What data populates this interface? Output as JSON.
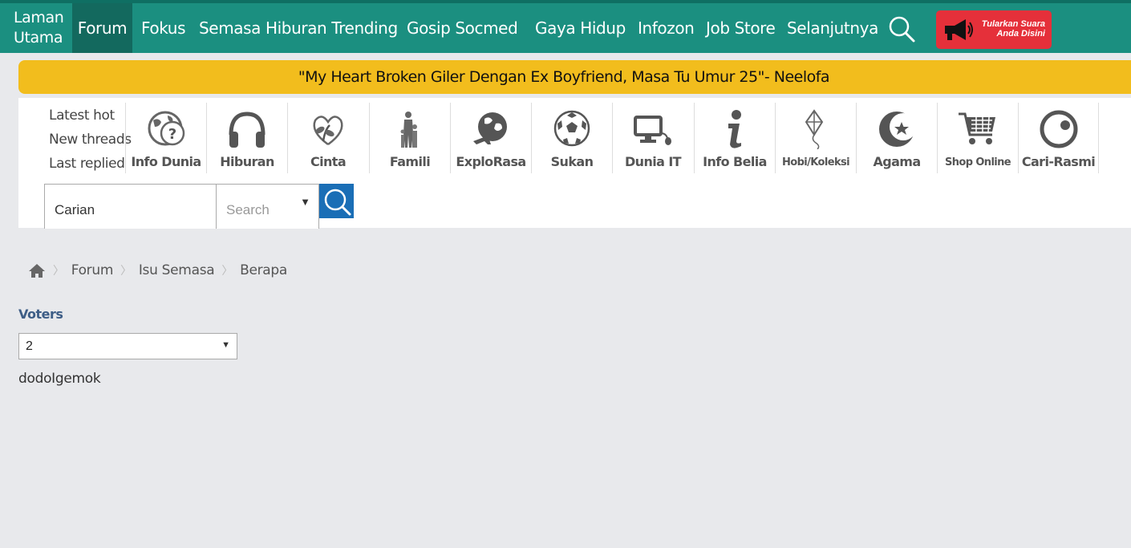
{
  "nav": {
    "home_line1": "Laman",
    "home_line2": "Utama",
    "items": [
      "Forum",
      "Fokus",
      "Semasa",
      "Hiburan Trending",
      "Gosip Socmed",
      "Gaya Hidup",
      "Infozon",
      "Job Store",
      "Selanjutnya"
    ],
    "active": "Forum",
    "promo_line1": "Tularkan Suara",
    "promo_line2": "Anda Disini"
  },
  "headline": "\"My Heart Broken Giler Dengan Ex Boyfriend, Masa Tu Umur 25\"- Neelofa",
  "quick_links": [
    "Latest hot",
    "New threads",
    "Last replied"
  ],
  "categories": [
    {
      "label": "Info Dunia",
      "icon": "globe-question-icon"
    },
    {
      "label": "Hiburan",
      "icon": "headphones-icon"
    },
    {
      "label": "Cinta",
      "icon": "heart-flower-icon"
    },
    {
      "label": "Famili",
      "icon": "family-icon"
    },
    {
      "label": "ExploRasa",
      "icon": "globe-plane-icon"
    },
    {
      "label": "Sukan",
      "icon": "soccer-ball-icon"
    },
    {
      "label": "Dunia IT",
      "icon": "computer-icon"
    },
    {
      "label": "Info Belia",
      "icon": "info-icon"
    },
    {
      "label": "Hobi/Koleksi",
      "icon": "kite-icon"
    },
    {
      "label": "Agama",
      "icon": "crescent-star-icon"
    },
    {
      "label": "Shop Online",
      "icon": "shopping-cart-icon"
    },
    {
      "label": "Cari-Rasmi",
      "icon": "cari-logo-icon"
    }
  ],
  "search": {
    "value": "Carian",
    "placeholder": "Search"
  },
  "breadcrumb": [
    "Forum",
    "Isu Semasa",
    "Berapa"
  ],
  "voters": {
    "label": "Voters",
    "selected": "2",
    "names": [
      "dodoIgemok"
    ]
  },
  "colors": {
    "nav_bg": "#1b8f80",
    "nav_active": "#13695e",
    "headline_bg": "#f2bd1d",
    "promo_bg": "#e5303a",
    "search_btn": "#1a6eb6",
    "page_bg": "#e8e9ec"
  }
}
